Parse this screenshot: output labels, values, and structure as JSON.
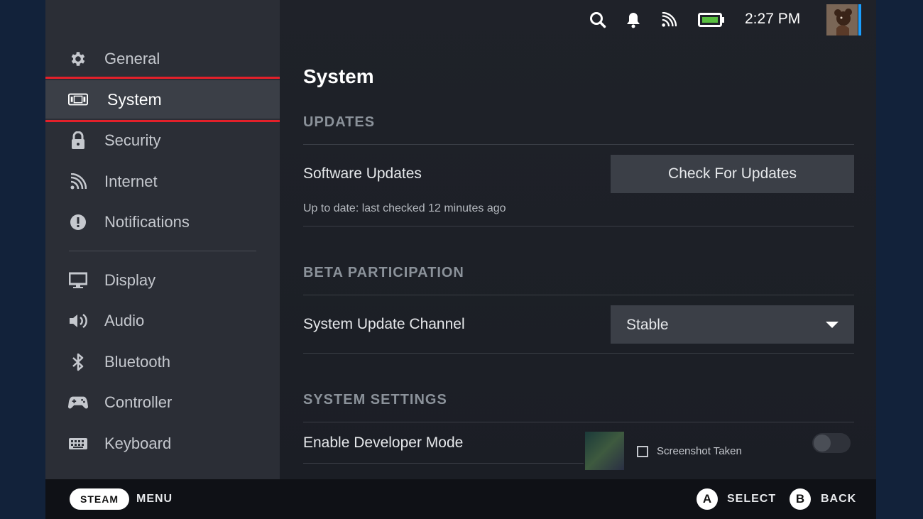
{
  "status_bar": {
    "time": "2:27 PM",
    "icons": [
      "search-icon",
      "bell-icon",
      "wifi-icon",
      "battery-icon"
    ]
  },
  "sidebar": {
    "items": [
      {
        "label": "General",
        "icon": "gear-icon"
      },
      {
        "label": "System",
        "icon": "device-icon",
        "active": true
      },
      {
        "label": "Security",
        "icon": "lock-icon"
      },
      {
        "label": "Internet",
        "icon": "wifi-icon"
      },
      {
        "label": "Notifications",
        "icon": "alert-icon"
      },
      {
        "label": "Display",
        "icon": "monitor-icon"
      },
      {
        "label": "Audio",
        "icon": "speaker-icon"
      },
      {
        "label": "Bluetooth",
        "icon": "bluetooth-icon"
      },
      {
        "label": "Controller",
        "icon": "gamepad-icon"
      },
      {
        "label": "Keyboard",
        "icon": "keyboard-icon"
      }
    ]
  },
  "main": {
    "title": "System",
    "updates": {
      "section": "UPDATES",
      "label": "Software Updates",
      "button": "Check For Updates",
      "status": "Up to date: last checked 12 minutes ago"
    },
    "beta": {
      "section": "BETA PARTICIPATION",
      "label": "System Update Channel",
      "selected": "Stable"
    },
    "settings": {
      "section": "SYSTEM SETTINGS",
      "label": "Enable Developer Mode",
      "toggle_on": false
    }
  },
  "toast": {
    "text": "Screenshot Taken"
  },
  "bottom_bar": {
    "steam": "STEAM",
    "menu": "MENU",
    "a": "A",
    "select": "SELECT",
    "b": "B",
    "back": "BACK"
  },
  "colors": {
    "highlight": "#e3202a",
    "accent": "#1a9fff",
    "sidebar_bg": "#2b2e36",
    "active_bg": "#3b3f47"
  }
}
